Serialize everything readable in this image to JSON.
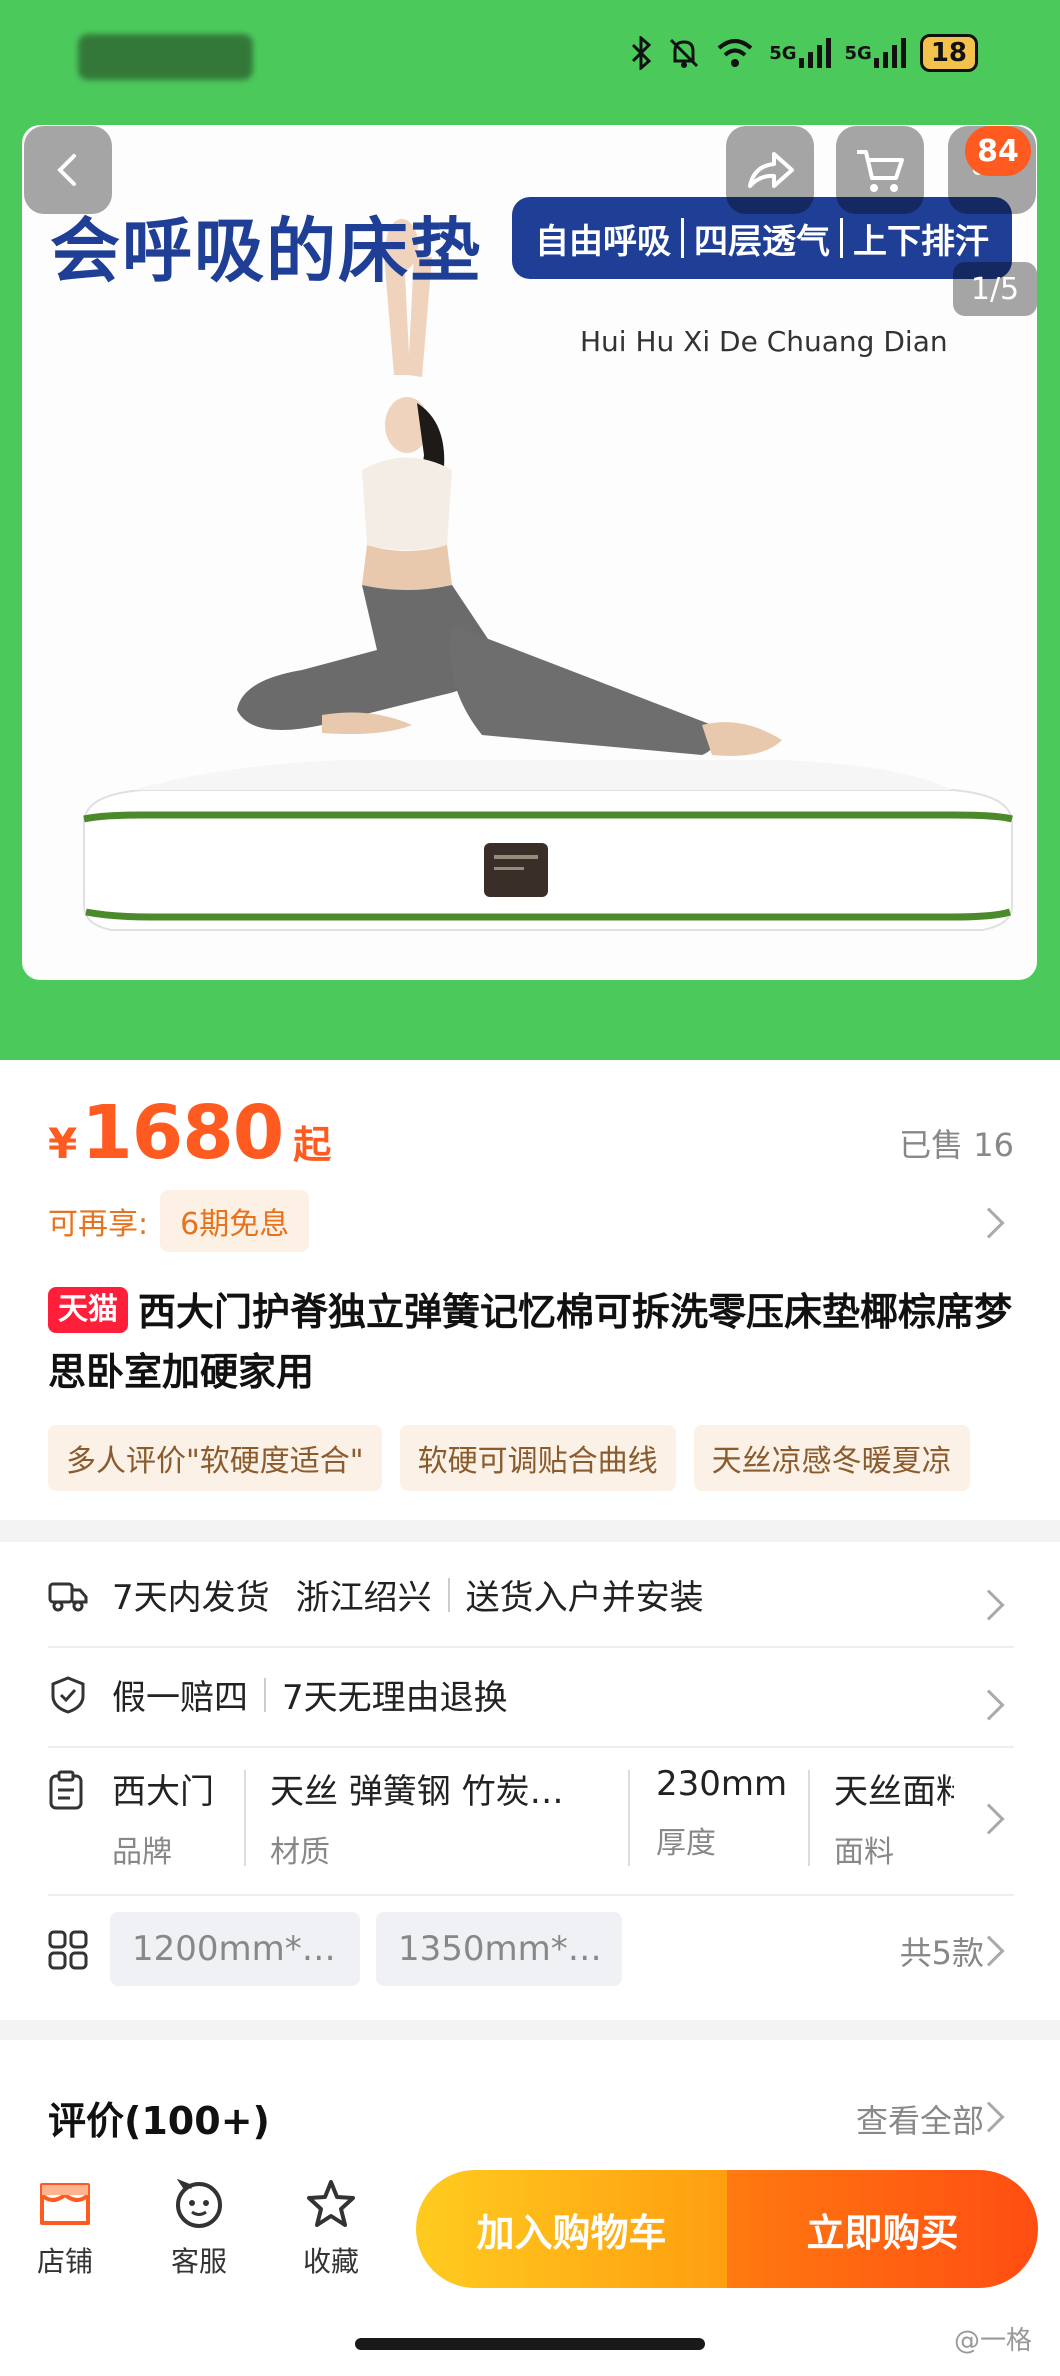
{
  "status_bar": {
    "signal_1": "5G",
    "signal_2": "5G",
    "battery": "18"
  },
  "hero": {
    "headline": "会呼吸的床垫",
    "pill": [
      "自由呼吸",
      "四层透气",
      "上下排汗"
    ],
    "subtitle": "Hui Hu Xi De Chuang Dian",
    "cart_badge": "84",
    "indicator": "1/5"
  },
  "product": {
    "currency": "¥",
    "price": "1680",
    "price_suffix": "起",
    "sold": "已售 16",
    "installment_label": "可再享:",
    "installment_chip": "6期免息",
    "tmall_badge": "天猫",
    "title": "西大门护脊独立弹簧记忆棉可拆洗零压床垫椰棕席梦思卧室加硬家用",
    "tags": [
      "多人评价\"软硬度适合\"",
      "软硬可调贴合曲线",
      "天丝凉感冬暖夏凉"
    ]
  },
  "service": {
    "shipping": [
      "7天内发货",
      "浙江绍兴",
      "送货入户并安装"
    ],
    "guarantee": [
      "假一赔四",
      "7天无理由退换"
    ],
    "specs": [
      {
        "value": "西大门",
        "label": "品牌"
      },
      {
        "value": "天丝 弹簧钢 竹炭…",
        "label": "材质"
      },
      {
        "value": "230mm",
        "label": "厚度"
      },
      {
        "value": "天丝面料",
        "label": "面料"
      }
    ],
    "sizes": [
      "1200mm*…",
      "1350mm*…"
    ],
    "sizes_total": "共5款"
  },
  "reviews": {
    "title": "评价(100+)",
    "see_all": "查看全部"
  },
  "bottom_bar": {
    "store": "店铺",
    "service": "客服",
    "favorite": "收藏",
    "add_to_cart": "加入购物车",
    "buy_now": "立即购买"
  },
  "watermark": "@一格",
  "colors": {
    "brand_green": "#4cc95b",
    "price_orange": "#ff5a1f",
    "tmall_red": "#ff1f3a",
    "headline_blue": "#1f3e96"
  }
}
